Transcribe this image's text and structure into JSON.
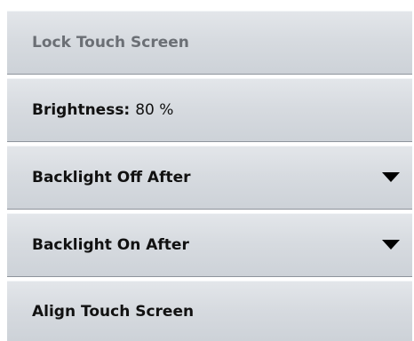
{
  "menu": {
    "lock_touch_screen": {
      "label": "Lock Touch Screen",
      "enabled": false
    },
    "brightness": {
      "label": "Brightness:",
      "value": "80 %"
    },
    "backlight_off_after": {
      "label": "Backlight Off After",
      "icon": "dropdown-arrow-icon"
    },
    "backlight_on_after": {
      "label": "Backlight On After",
      "icon": "dropdown-arrow-icon"
    },
    "align_touch_screen": {
      "label": "Align Touch Screen"
    }
  }
}
